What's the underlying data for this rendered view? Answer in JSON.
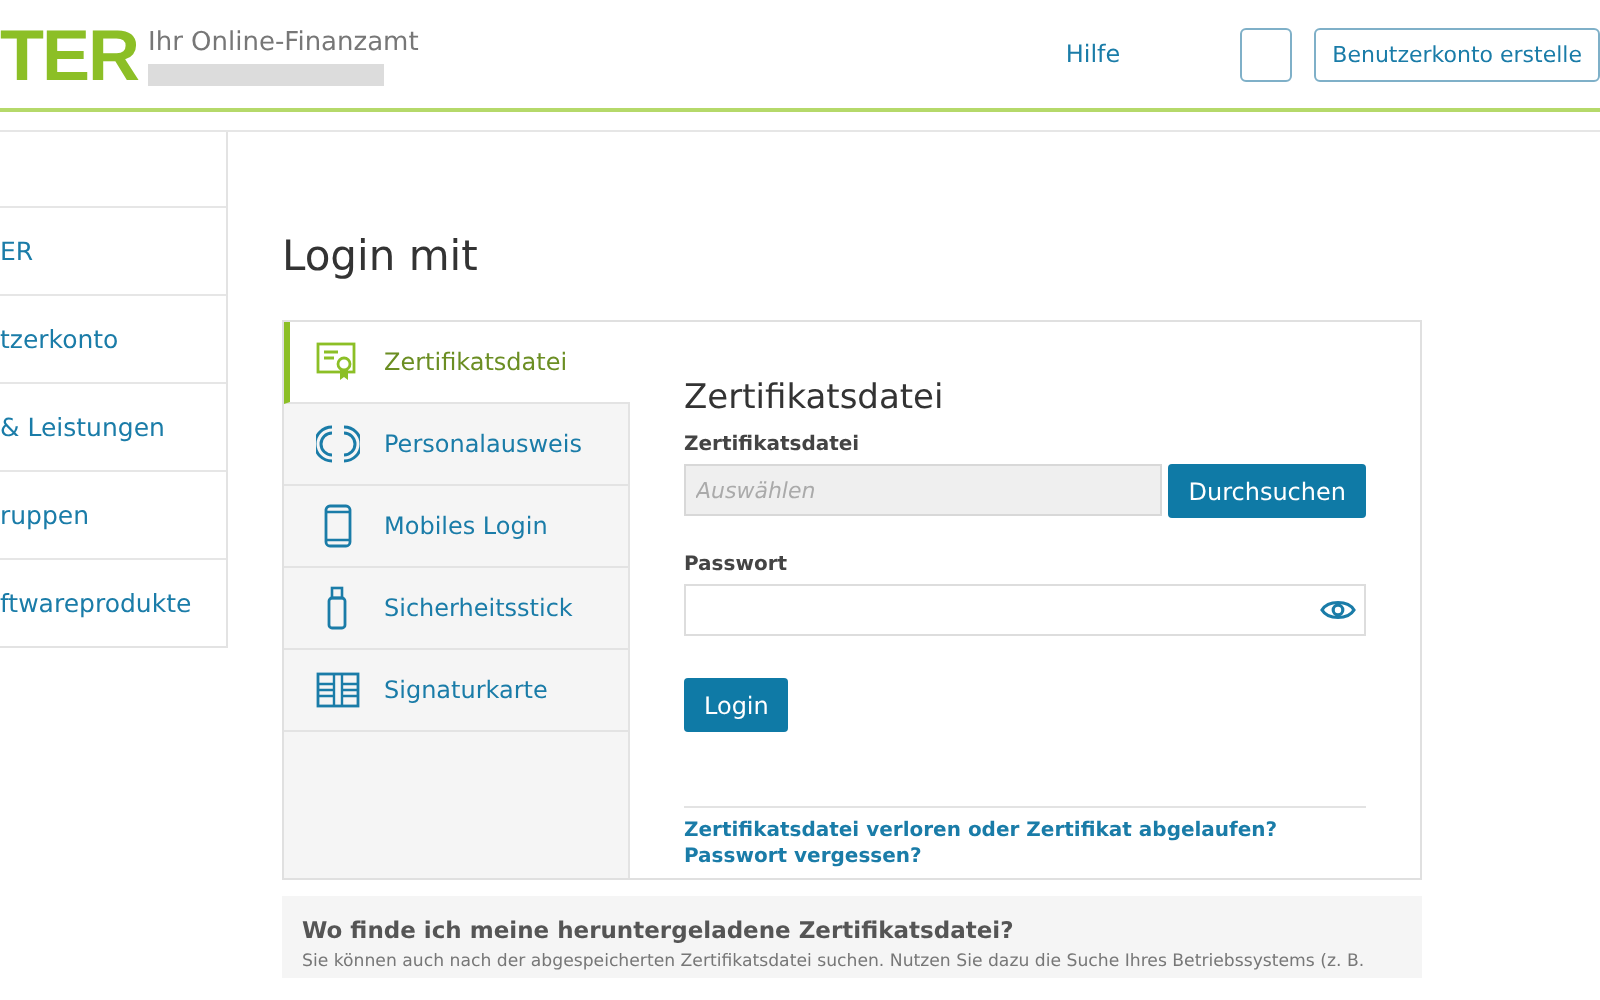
{
  "header": {
    "logo": "TER",
    "tagline": "Ihr Online-Finanzamt",
    "help_link": "Hilfe",
    "create_account_button": "Benutzerkonto erstelle"
  },
  "sidebar": {
    "items": [
      {
        "label": "ER"
      },
      {
        "label": "tzerkonto"
      },
      {
        "label": "& Leistungen"
      },
      {
        "label": "ruppen"
      },
      {
        "label": "ftwareprodukte"
      }
    ]
  },
  "page_title": "Login mit",
  "login_methods": [
    {
      "label": "Zertifikatsdatei",
      "kind": "certificate",
      "selected": true
    },
    {
      "label": "Personalausweis",
      "kind": "idcard",
      "selected": false
    },
    {
      "label": "Mobiles Login",
      "kind": "phone",
      "selected": false
    },
    {
      "label": "Sicherheitsstick",
      "kind": "stick",
      "selected": false
    },
    {
      "label": "Signaturkarte",
      "kind": "chipcard",
      "selected": false
    }
  ],
  "form": {
    "title": "Zertifikatsdatei",
    "file_label": "Zertifikatsdatei",
    "file_placeholder": "Auswählen",
    "browse_button": "Durchsuchen",
    "password_label": "Passwort",
    "login_button": "Login",
    "links": [
      "Zertifikatsdatei verloren oder Zertifikat abgelaufen?",
      "Passwort vergessen?"
    ]
  },
  "info": {
    "title": "Wo finde ich meine heruntergeladene Zertifikatsdatei?",
    "text": "Sie können auch nach der abgespeicherten Zertifikatsdatei suchen. Nutzen Sie dazu die Suche Ihres Betriebssystems (z. B."
  }
}
